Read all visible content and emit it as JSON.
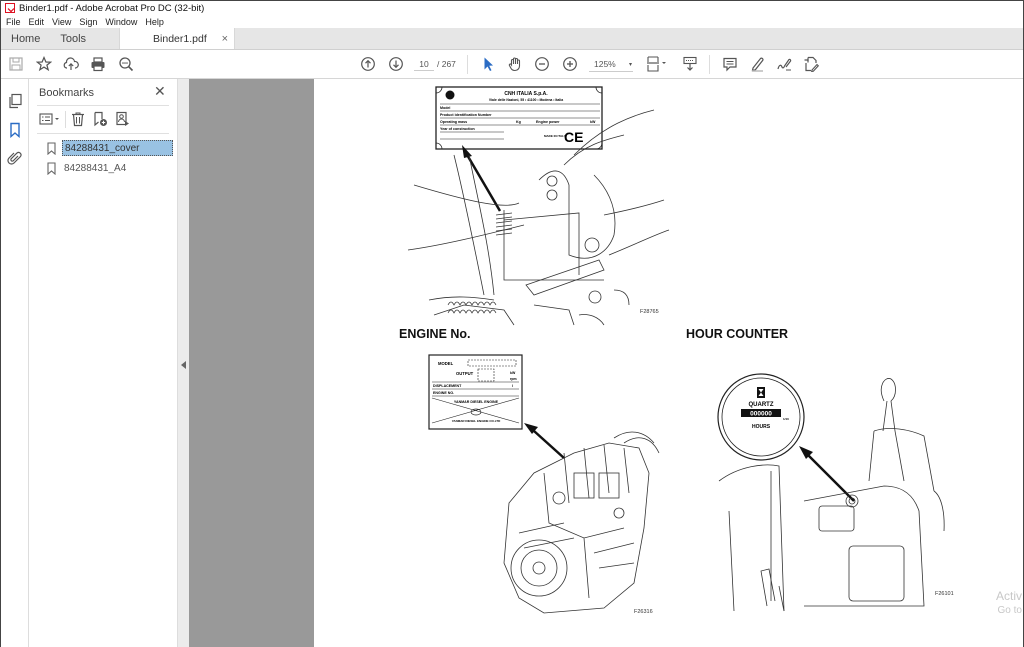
{
  "window": {
    "title": "Binder1.pdf - Adobe Acrobat Pro DC (32-bit)"
  },
  "menu": [
    "File",
    "Edit",
    "View",
    "Sign",
    "Window",
    "Help"
  ],
  "tabs": {
    "home": "Home",
    "tools": "Tools",
    "document": "Binder1.pdf",
    "close_glyph": "×"
  },
  "toolbar": {
    "current_page": "10",
    "total_pages": "/ 267",
    "zoom_level": "125%",
    "zoom_caret": "▾",
    "icons": [
      "save-icon",
      "bookmark-star-icon",
      "upload-cloud-icon",
      "print-icon",
      "search-zoom-icon",
      "previous-page-icon",
      "next-page-icon",
      "select-arrow-icon",
      "hand-pan-icon",
      "zoom-out-icon",
      "zoom-in-icon",
      "page-fit-icon",
      "scroll-mode-icon",
      "comment-icon",
      "highlight-pen-icon",
      "sign-icon",
      "fill-sign-icon"
    ]
  },
  "panel": {
    "title": "Bookmarks",
    "close_glyph": "✕",
    "bookmarks": [
      {
        "label": "84288431_cover",
        "selected": true
      },
      {
        "label": "84288431_A4",
        "selected": false
      }
    ]
  },
  "page": {
    "plate": {
      "company": "CNH  ITALIA  S.p.A.",
      "address": "Viale delle Nazioni, 55 • 41100 • Modena • Italia",
      "rows": [
        "Model",
        "Product identification Number",
        "Operating mass",
        "Year of construction"
      ],
      "mass_unit": "Kg",
      "engine_power": "Engine power",
      "power_unit": "kW",
      "made_in": "MADE IN ITALY",
      "ce_mark": "CE"
    },
    "figure1_id": "F28765",
    "engine_title": "ENGINE No.",
    "engine_plate": {
      "model": "MODEL",
      "output": "OUTPUT",
      "kw": "kW",
      "rpm": "rpm",
      "displacement": "DISPLACEMENT",
      "l": "l",
      "engine_no": "ENGINE NO.",
      "maker": "YANMAR DIESEL ENGINE",
      "company": "YANMAR DIESEL ENGINE CO.LTD"
    },
    "figure2_id": "F26316",
    "hour_title": "HOUR COUNTER",
    "hour_counter": {
      "brand": "QUARTZ",
      "digits": "000000",
      "tenth": "1/10",
      "unit": "HOURS"
    },
    "figure3_id": "F26101"
  },
  "watermark": {
    "line1": "Activ",
    "line2": "Go to"
  }
}
